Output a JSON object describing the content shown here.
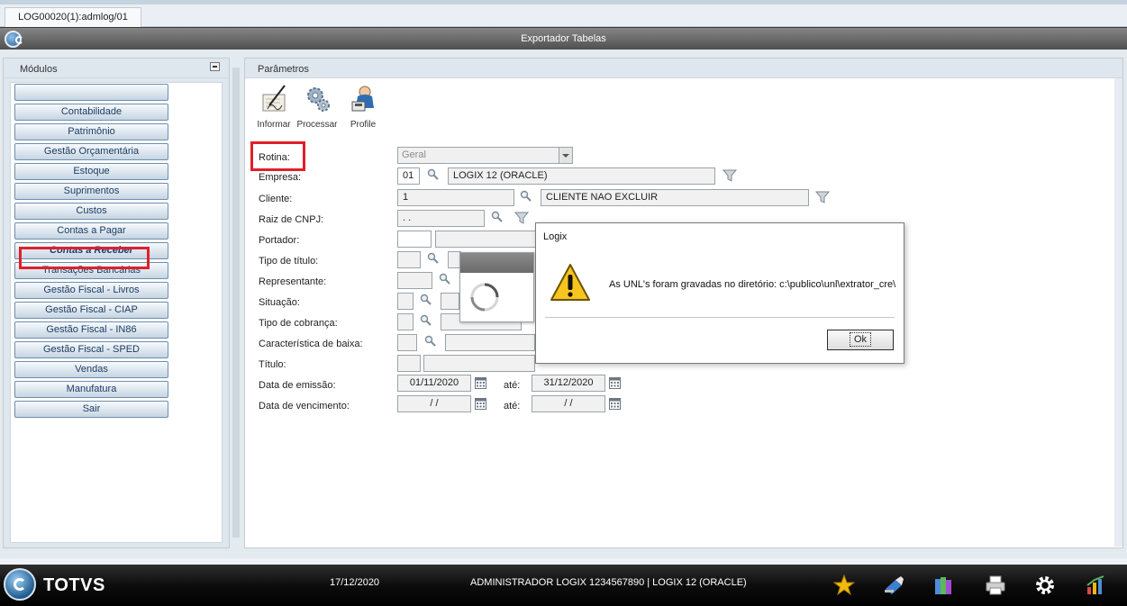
{
  "tab": {
    "label": "LOG00020(1):admlog/01"
  },
  "window": {
    "title": "Exportador Tabelas"
  },
  "left_panel": {
    "title": "Módulos",
    "modules": [
      "",
      "Contabilidade",
      "Patrimônio",
      "Gestão Orçamentária",
      "Estoque",
      "Suprimentos",
      "Custos",
      "Contas a Pagar",
      "Contas a Receber",
      "Transações Bancárias",
      "Gestão Fiscal - Livros",
      "Gestão Fiscal - CIAP",
      "Gestão Fiscal - IN86",
      "Gestão Fiscal - SPED",
      "Vendas",
      "Manufatura",
      "Sair"
    ],
    "active_module": "Contas a Receber"
  },
  "right_panel": {
    "title": "Parâmetros",
    "toolbar": {
      "informar": "Informar",
      "processar": "Processar",
      "profile": "Profile"
    }
  },
  "form": {
    "rotina": {
      "label": "Rotina:",
      "value": "Geral"
    },
    "empresa": {
      "label": "Empresa:",
      "code": "01",
      "name": "LOGIX 12 (ORACLE)"
    },
    "cliente": {
      "label": "Cliente:",
      "code": "1",
      "name": "CLIENTE NAO EXCLUIR"
    },
    "raiz_cnpj": {
      "label": "Raiz de CNPJ:",
      "value": ".   ."
    },
    "portador": {
      "label": "Portador:"
    },
    "tipo_titulo": {
      "label": "Tipo de título:"
    },
    "representante": {
      "label": "Representante:"
    },
    "situacao": {
      "label": "Situação:"
    },
    "tipo_cobranca": {
      "label": "Tipo de cobrança:"
    },
    "caracteristica_baixa": {
      "label": "Característica de baixa:"
    },
    "titulo": {
      "label": "Título:"
    },
    "data_emissao": {
      "label": "Data de emissão:",
      "from": "01/11/2020",
      "ate_label": "até:",
      "to": "31/12/2020"
    },
    "data_vencimento": {
      "label": "Data de vencimento:",
      "from": "/ /",
      "ate_label": "até:",
      "to": "/ /"
    }
  },
  "dialog": {
    "title": "Logix",
    "message": "As UNL's foram gravadas no diretório: c:\\publico\\unl\\extrator_cre\\",
    "ok_label": "Ok"
  },
  "statusbar": {
    "brand": "TOTVS",
    "date": "17/12/2020",
    "user_info": "ADMINISTRADOR LOGIX 1234567890 | LOGIX 12 (ORACLE)"
  },
  "colors": {
    "highlight": "#e0202a",
    "module_button_text": "#1d3d63",
    "title_bar": "#5f5f5f"
  }
}
